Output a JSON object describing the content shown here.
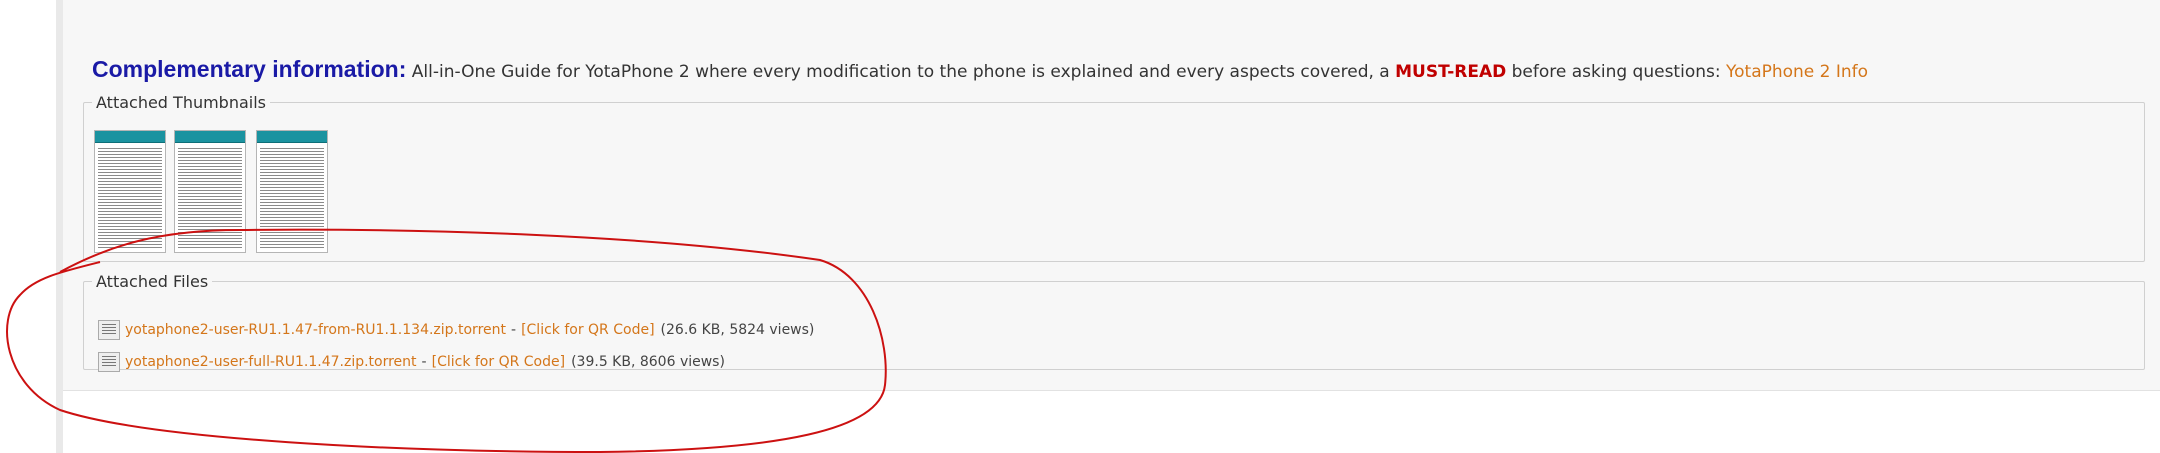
{
  "complementary": {
    "title": "Complementary information:",
    "text_before": "All-in-One Guide for YotaPhone 2 where every modification to the phone is explained and every aspects covered, a",
    "must_read": "MUST-READ",
    "text_after": "before asking questions:",
    "link_label": "YotaPhone 2 Info"
  },
  "attached_thumbnails": {
    "legend": "Attached Thumbnails",
    "thumbnails": [
      {},
      {},
      {}
    ]
  },
  "attached_files": {
    "legend": "Attached Files",
    "files": [
      {
        "name": "yotaphone2-user-RU1.1.47-from-RU1.1.134.zip.torrent",
        "qr_label": "[Click for QR Code]",
        "meta": "(26.6 KB, 5824 views)"
      },
      {
        "name": "yotaphone2-user-full-RU1.1.47.zip.torrent",
        "qr_label": "[Click for QR Code]",
        "meta": "(39.5 KB, 8606 views)"
      }
    ]
  },
  "colors": {
    "title": "#1a1aa6",
    "must_read": "#c00000",
    "link": "#d4761a",
    "thumbnail_header": "#1b93a0",
    "annotation": "#cc1111"
  }
}
